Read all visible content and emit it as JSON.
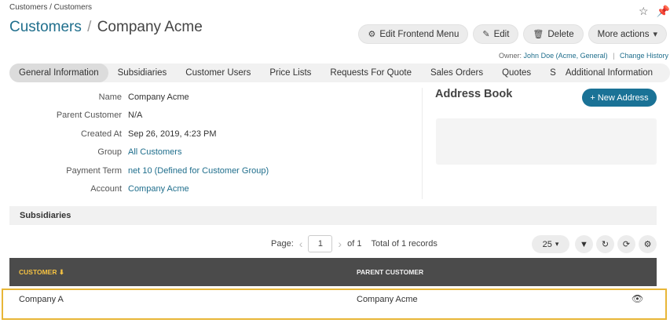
{
  "breadcrumb": "Customers / Customers",
  "top_icons": [
    "star-icon",
    "pin-icon"
  ],
  "title": {
    "link": "Customers",
    "separator": "/",
    "name": "Company Acme"
  },
  "actions": [
    {
      "icon": "gear-icon",
      "glyph": "⚙",
      "label": "Edit Frontend Menu"
    },
    {
      "icon": "edit-icon",
      "glyph": "✎",
      "label": "Edit"
    },
    {
      "icon": "trash-icon",
      "glyph": "🗑",
      "label": "Delete"
    },
    {
      "icon": "chevron-down-icon",
      "glyph": "▾",
      "label": "More actions"
    }
  ],
  "owner": {
    "label": "Owner:",
    "value": "John Doe (Acme, General)",
    "change": "Change History"
  },
  "tabs": [
    {
      "label": "General Information",
      "active": true
    },
    {
      "label": "Subsidiaries"
    },
    {
      "label": "Customer Users"
    },
    {
      "label": "Price Lists"
    },
    {
      "label": "Requests For Quote"
    },
    {
      "label": "Sales Orders"
    },
    {
      "label": "Quotes"
    },
    {
      "label": "S"
    },
    {
      "label": "Additional Information"
    }
  ],
  "info": [
    {
      "label": "Name",
      "value": "Company Acme",
      "link": false
    },
    {
      "label": "Parent Customer",
      "value": "N/A",
      "link": false
    },
    {
      "label": "Created At",
      "value": "Sep 26, 2019, 4:23 PM",
      "link": false
    },
    {
      "label": "Group",
      "value": "All Customers",
      "link": true
    },
    {
      "label": "Payment Term",
      "value": "net 10 (Defined for Customer Group)",
      "link": true
    },
    {
      "label": "Account",
      "value": "Company Acme",
      "link": true
    }
  ],
  "address_book": {
    "title": "Address Book",
    "button": "+ New Address"
  },
  "subsidiaries": {
    "title": "Subsidiaries",
    "pager": {
      "page_label": "Page:",
      "page": "1",
      "of": "of 1",
      "total": "Total of 1 records",
      "per_page": "25"
    },
    "columns": [
      "CUSTOMER",
      "PARENT CUSTOMER"
    ],
    "sort_indicator": "⬇",
    "rows": [
      {
        "customer": "Company A",
        "parent": "Company Acme"
      }
    ]
  },
  "colors": {
    "accent": "#1f6e8c",
    "primary_button": "#1a7296",
    "table_header": "#4b4b4b",
    "sort_highlight": "#f5c242",
    "row_outline": "#e8b637"
  }
}
